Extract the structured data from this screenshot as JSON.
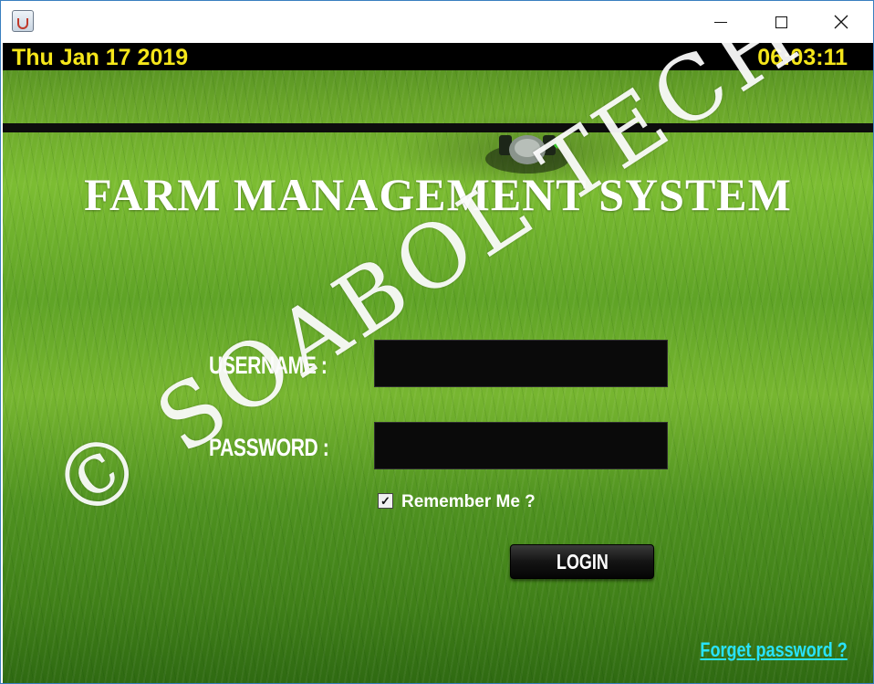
{
  "window": {
    "controls": {
      "minimize": "minimize",
      "maximize": "maximize",
      "close": "close"
    }
  },
  "header": {
    "date": "Thu Jan 17 2019",
    "time": "06:03:11"
  },
  "app": {
    "title": "FARM MANAGEMENT SYSTEM"
  },
  "form": {
    "username_label": "USERNAME :",
    "password_label": "PASSWORD :",
    "username_value": "",
    "password_value": "",
    "remember_label": "Remember Me ?",
    "remember_checked": true,
    "login_label": "LOGIN",
    "forgot_label": "Forget password ?"
  },
  "watermark": {
    "text": "© SOABOL TECH"
  },
  "colors": {
    "header_text": "#f5e61a",
    "link": "#28e3ff",
    "field_bg": "#0a0a0a"
  },
  "icons": {
    "app": "java-cup-icon",
    "minimize": "minimize-icon",
    "maximize": "maximize-icon",
    "close": "close-icon",
    "checkbox": "checkbox-checked-icon"
  }
}
